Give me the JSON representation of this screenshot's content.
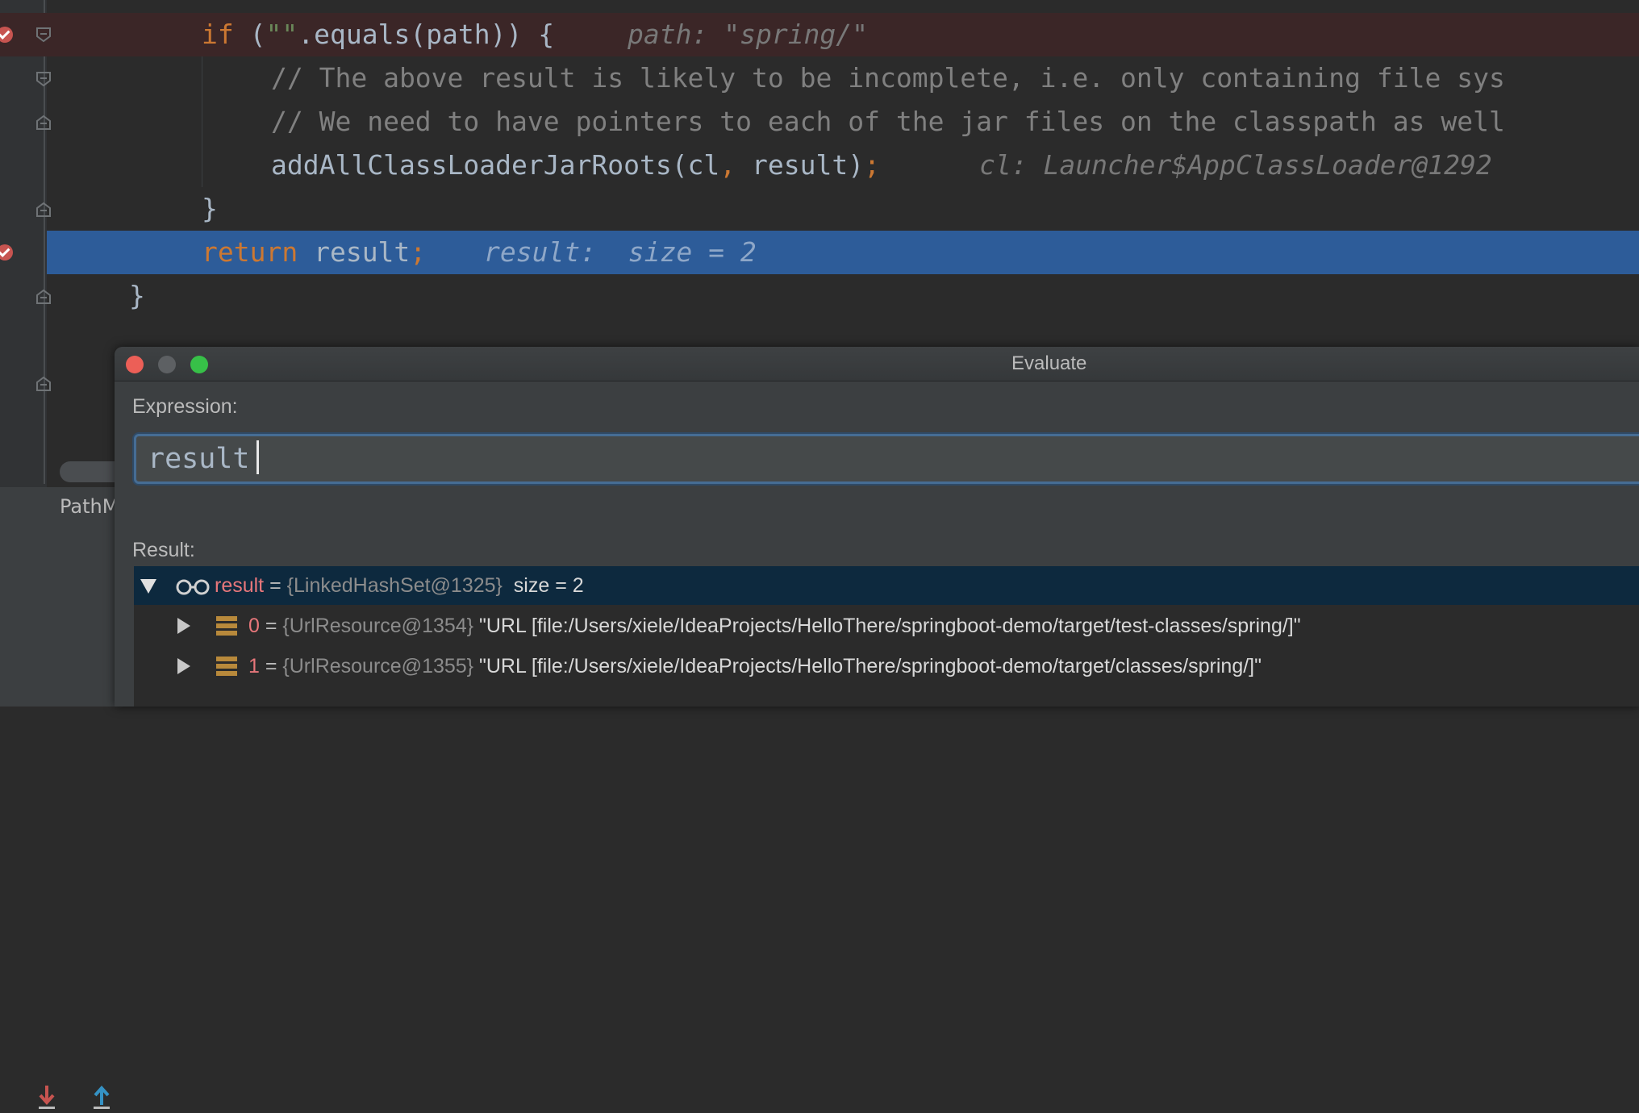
{
  "editor": {
    "line1": {
      "kw": "if",
      "open": " (",
      "str": "\"\"",
      "rest": ".equals(path)) {",
      "hint_name": "path:",
      "hint_value": "\"spring/\""
    },
    "line2": {
      "comment": "// The above result is likely to be incomplete, i.e. only containing file sys"
    },
    "line3": {
      "comment": "// We need to have pointers to each of the jar files on the classpath as well"
    },
    "line4": {
      "call": "addAllClassLoaderJarRoots(cl",
      "comma": ",",
      "arg": " result)",
      "semi": ";",
      "hint": "cl: Launcher$AppClassLoader@1292"
    },
    "line5": {
      "text": "}"
    },
    "line6": {
      "kw": "return",
      "text": " result",
      "semi": ";",
      "hint": "result:  size = 2"
    },
    "line7": {
      "text": "}"
    }
  },
  "toolwindow": {
    "title": "PathM",
    "icons": [
      "step-into-icon",
      "step-out-icon"
    ]
  },
  "dialog": {
    "title": "Evaluate",
    "expression_label": "Expression:",
    "expression_value": "result",
    "result_label": "Result:",
    "tree": {
      "root": {
        "name": "result",
        "eq": " = ",
        "type": "{LinkedHashSet@1325}",
        "value": "size = 2"
      },
      "children": [
        {
          "index": "0",
          "eq": " = ",
          "type": "{UrlResource@1354}",
          "value": "\"URL [file:/Users/xiele/IdeaProjects/HelloThere/springboot-demo/target/test-classes/spring/]\""
        },
        {
          "index": "1",
          "eq": " = ",
          "type": "{UrlResource@1355}",
          "value": "\"URL [file:/Users/xiele/IdeaProjects/HelloThere/springboot-demo/target/classes/spring/]\""
        }
      ]
    }
  },
  "colors": {
    "editor_bg": "#2b2b2b",
    "keyword": "#cc7832",
    "string": "#6a8759",
    "comment": "#808080",
    "breakpoint_line": "#3b2627",
    "execution_line": "#2d5c99",
    "selection": "#0d293e"
  }
}
